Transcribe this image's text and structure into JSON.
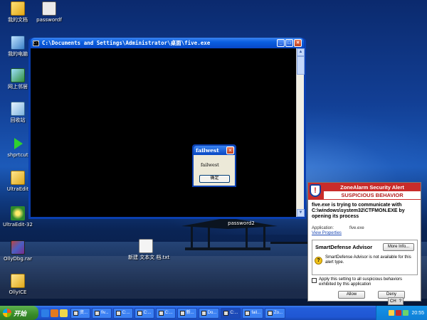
{
  "desktop": {
    "icons": [
      {
        "name": "desktop-icon-my-documents",
        "label": "我的文档",
        "icon": "folder-icon"
      },
      {
        "name": "desktop-icon-passwordf",
        "label": "passwordf",
        "icon": "file-icon"
      },
      {
        "name": "desktop-icon-my-computer",
        "label": "我的电脑",
        "icon": "computer-icon"
      },
      {
        "name": "desktop-icon-network",
        "label": "网上邻居",
        "icon": "network-icon"
      },
      {
        "name": "desktop-icon-recycle-bin",
        "label": "回收站",
        "icon": "recycle-bin-icon"
      },
      {
        "name": "desktop-icon-shortcut",
        "label": "shprtcut",
        "icon": "arrow-icon"
      },
      {
        "name": "desktop-icon-ultraedit-folder",
        "label": "UltraEdit",
        "icon": "folder-icon"
      },
      {
        "name": "desktop-icon-ultraedit32",
        "label": "UltraEdit-32",
        "icon": "ultraedit-icon"
      },
      {
        "name": "desktop-icon-ollydbg-rar",
        "label": "OllyDbg.rar",
        "icon": "rar-icon"
      },
      {
        "name": "desktop-icon-ollyice",
        "label": "OllyICE",
        "icon": "folder-icon"
      },
      {
        "name": "desktop-icon-text-file",
        "label": "新建 文本文 档.txt",
        "icon": "text-file-icon"
      },
      {
        "name": "desktop-icon-password2",
        "label": "password2",
        "icon": "file-icon"
      }
    ]
  },
  "console": {
    "title": "C:\\Documents and Settings\\Administrator\\桌面\\five.exe",
    "cmd_icon_text": "C:\\",
    "minimize": "_",
    "maximize": "□",
    "close": "×"
  },
  "msgbox": {
    "title": "failwest",
    "message": "failwest",
    "ok_label": "确定",
    "close": "×"
  },
  "zonealarm": {
    "logo_text": "!",
    "title": "ZoneAlarm Security Alert",
    "subtitle": "SUSPICIOUS BEHAVIOR",
    "description": "five.exe is trying to communicate with C:\\windows\\system32\\CTFMON.EXE by opening its process",
    "application_label": "Application:",
    "application_value": "five.exe",
    "view_properties": "View Properties",
    "advisor_title": "SmartDefense Advisor",
    "more_info": "More Info...",
    "advisor_icon": "?",
    "advisor_text": "SmartDefense Advisor is not available for this alert type.",
    "apply_label": "Apply this setting to all suspicious behaviors exhibited by this application",
    "allow_label": "Allow",
    "deny_label": "Deny"
  },
  "taskbar": {
    "start_label": "开始",
    "tasks": [
      {
        "label": "资...",
        "active": false
      },
      {
        "label": "fiv...",
        "active": false
      },
      {
        "label": "C:...",
        "active": false
      },
      {
        "label": "C:...",
        "active": false
      },
      {
        "label": "C:...",
        "active": false
      },
      {
        "label": "新...",
        "active": false
      },
      {
        "label": "Do...",
        "active": false
      },
      {
        "label": "C:...",
        "active": true
      },
      {
        "label": "fail...",
        "active": false
      },
      {
        "label": "Zo...",
        "active": false
      }
    ],
    "language": "CH",
    "clock": "20:55"
  },
  "colors": {
    "xp_blue": "#0a3fb0",
    "za_red": "#c92c2a",
    "start_green": "#388c2a"
  }
}
